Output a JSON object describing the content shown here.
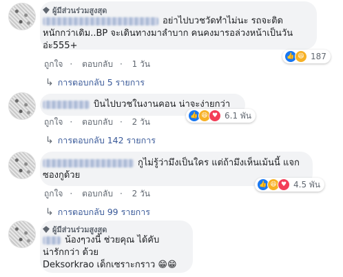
{
  "comments": [
    {
      "badge": "ผู้มีส่วนร่วมสูงสุด",
      "text_line1": "อย่าไปบวชวัดทำไม่นะ รถจะติด",
      "text_line2": "หนักกว่าเดิม..BP จะเดินทางมาลำบาก คนคงมารอล่วงหน้าเป็นวัน",
      "text_line3": "อ่ะ555+",
      "actions": {
        "like": "ถูกใจ",
        "reply": "ตอบกลับ",
        "time": "1 วัน"
      },
      "reaction_count": "187",
      "replies": "การตอบกลับ 5 รายการ"
    },
    {
      "text_line1": "บินไปบวชในงานคอน น่าจะง่ายกว่า",
      "actions": {
        "like": "ถูกใจ",
        "reply": "ตอบกลับ",
        "time": "2 วัน"
      },
      "reaction_count": "6.1 พัน",
      "replies": "การตอบกลับ 142 รายการ"
    },
    {
      "text_line1": "กูไม่รู้ว่ามึงเป็นใคร แต่ถ้ามึงเห็นเม้นนี้ แจก",
      "text_line2": "ซองกูด้วย",
      "actions": {
        "like": "ถูกใจ",
        "reply": "ตอบกลับ",
        "time": "2 วัน"
      },
      "reaction_count": "4.5 พัน",
      "replies": "การตอบกลับ 99 รายการ"
    },
    {
      "badge": "ผู้มีส่วนร่วมสูงสุด",
      "text_line1": "น้องๆวงนี้ ช่วยคุณ ได้คับ",
      "text_line2": "น่ารักกว่า ด้วย",
      "text_line3": "Deksorkrao เด็กเซราะกราว 😁😁"
    }
  ],
  "separator": "·"
}
